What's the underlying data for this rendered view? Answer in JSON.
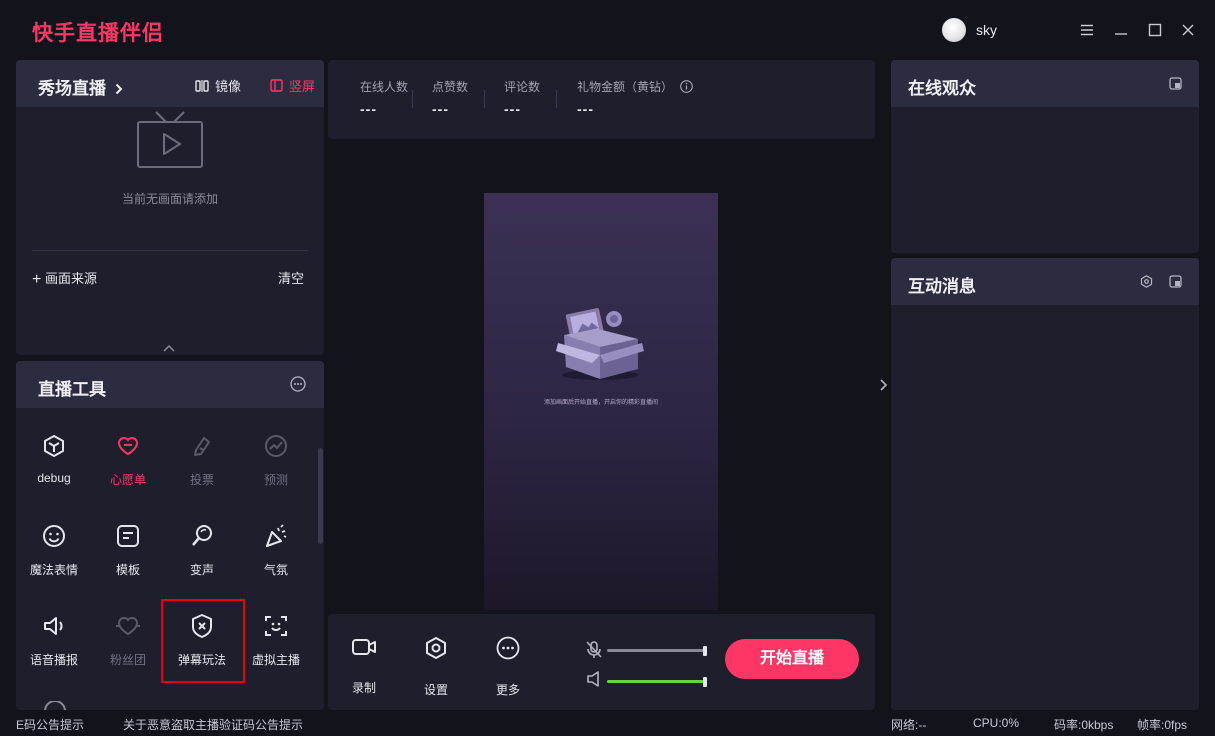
{
  "app": {
    "title": "快手直播伴侣",
    "username": "sky"
  },
  "scene": {
    "title": "秀场直播",
    "mirror_label": "镜像",
    "orientation_label": "竖屏",
    "empty_text": "当前无画面请添加",
    "add_source_label": "画面来源",
    "clear_label": "清空"
  },
  "tools": {
    "title": "直播工具",
    "items": [
      {
        "label": "debug",
        "icon": "cube-icon",
        "state": "normal"
      },
      {
        "label": "心愿单",
        "icon": "heart-icon",
        "state": "active"
      },
      {
        "label": "投票",
        "icon": "vote-icon",
        "state": "disabled"
      },
      {
        "label": "预测",
        "icon": "predict-icon",
        "state": "disabled"
      },
      {
        "label": "魔法表情",
        "icon": "smile-icon",
        "state": "normal"
      },
      {
        "label": "模板",
        "icon": "template-icon",
        "state": "normal"
      },
      {
        "label": "变声",
        "icon": "voice-change-icon",
        "state": "normal"
      },
      {
        "label": "气氛",
        "icon": "party-icon",
        "state": "normal"
      },
      {
        "label": "语音播报",
        "icon": "speaker-icon",
        "state": "normal"
      },
      {
        "label": "粉丝团",
        "icon": "fan-heart-icon",
        "state": "disabled"
      },
      {
        "label": "弹幕玩法",
        "icon": "shield-x-icon",
        "state": "normal"
      },
      {
        "label": "虚拟主播",
        "icon": "face-scan-icon",
        "state": "normal"
      }
    ]
  },
  "stats": {
    "online": {
      "label": "在线人数",
      "value": "---"
    },
    "likes": {
      "label": "点赞数",
      "value": "---"
    },
    "comments": {
      "label": "评论数",
      "value": "---"
    },
    "gifts": {
      "label": "礼物金额（黄钻）",
      "value": "---"
    }
  },
  "preview": {
    "hint": "添加画面后开始直播，开启你的精彩直播间"
  },
  "controls": {
    "record_label": "录制",
    "settings_label": "设置",
    "more_label": "更多",
    "start_label": "开始直播",
    "mic_level": 1.0,
    "speaker_level": 1.0,
    "colors": {
      "mic_track": "#8a8a96",
      "speaker_track": "#6fd13a",
      "accent": "#fe3666"
    }
  },
  "audience": {
    "title": "在线观众"
  },
  "messages": {
    "title": "互动消息"
  },
  "statusbar": {
    "notice_1": "E码公告提示",
    "notice_2": "关于恶意盗取主播验证码公告提示",
    "network": "网络:--",
    "cpu": "CPU:0%",
    "bitrate": "码率:0kbps",
    "framerate": "帧率:0fps"
  }
}
